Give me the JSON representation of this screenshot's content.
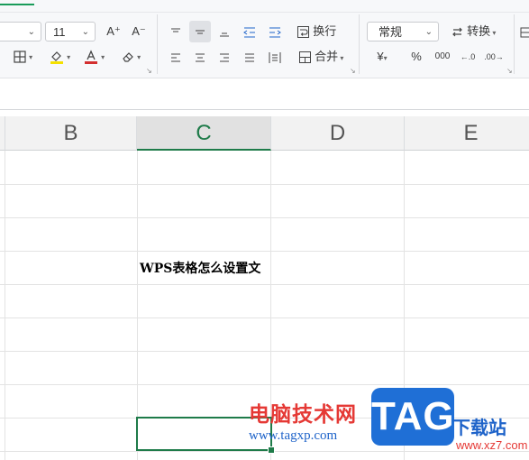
{
  "toolbar": {
    "font_size": "11",
    "increase_font_label": "A⁺",
    "decrease_font_label": "A⁻",
    "wrap_label": "换行",
    "merge_label": "合并",
    "number_format": "常规",
    "convert_label": "转换",
    "currency_label": "¥",
    "percent_label": "%",
    "thousands_label": "000",
    "increase_decimal_label": "←.0",
    "decrease_decimal_label": ".00→"
  },
  "sheet": {
    "columns": [
      "B",
      "C",
      "D",
      "E"
    ],
    "selected_column": "C",
    "cell_text": "WPS表格怎么设置文"
  },
  "watermark": {
    "cn_text": "电脑技术网",
    "url": "www.tagxp.com",
    "logo": "TAG",
    "site": "下载站",
    "url2": "www.xz7.com"
  },
  "colors": {
    "accent": "#1e7b49",
    "highlight_yellow": "#f5e100",
    "font_red": "#d32f2f"
  }
}
